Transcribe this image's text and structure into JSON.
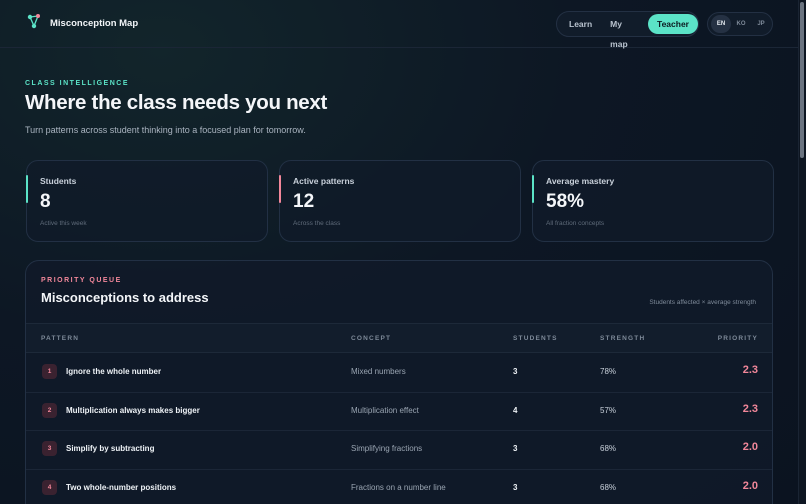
{
  "app": {
    "title": "Misconception Map"
  },
  "nav": {
    "items": [
      "Learn",
      "My map",
      "Teacher"
    ],
    "active": "Teacher"
  },
  "lang": {
    "items": [
      "EN",
      "KO",
      "JP"
    ],
    "active": "EN"
  },
  "hero": {
    "eyebrow": "CLASS INTELLIGENCE",
    "title": "Where the class needs you next",
    "subtitle": "Turn patterns across student thinking into a focused plan for tomorrow."
  },
  "stats": [
    {
      "label": "Students",
      "value": "8",
      "note": "Active this week",
      "color": "#5be3c7"
    },
    {
      "label": "Active patterns",
      "value": "12",
      "note": "Across the class",
      "color": "#f2879a"
    },
    {
      "label": "Average mastery",
      "value": "58%",
      "note": "All fraction concepts",
      "color": "#5be3c7"
    }
  ],
  "priority": {
    "eyebrow": "PRIORITY QUEUE",
    "title": "Misconceptions to address",
    "hint": "Students affected × average strength",
    "columns": [
      "PATTERN",
      "CONCEPT",
      "STUDENTS",
      "STRENGTH",
      "PRIORITY"
    ],
    "rows": [
      {
        "rank": "1",
        "pattern": "Ignore the whole number",
        "concept": "Mixed numbers",
        "students": "3",
        "strength": "78%",
        "priority": "2.3"
      },
      {
        "rank": "2",
        "pattern": "Multiplication always makes bigger",
        "concept": "Multiplication effect",
        "students": "4",
        "strength": "57%",
        "priority": "2.3"
      },
      {
        "rank": "3",
        "pattern": "Simplify by subtracting",
        "concept": "Simplifying fractions",
        "students": "3",
        "strength": "68%",
        "priority": "2.0"
      },
      {
        "rank": "4",
        "pattern": "Two whole-number positions",
        "concept": "Fractions on a number line",
        "students": "3",
        "strength": "68%",
        "priority": "2.0"
      }
    ]
  },
  "colors": {
    "accent": "#5be3c7",
    "alert": "#f2879a",
    "background": "#0b1320"
  }
}
